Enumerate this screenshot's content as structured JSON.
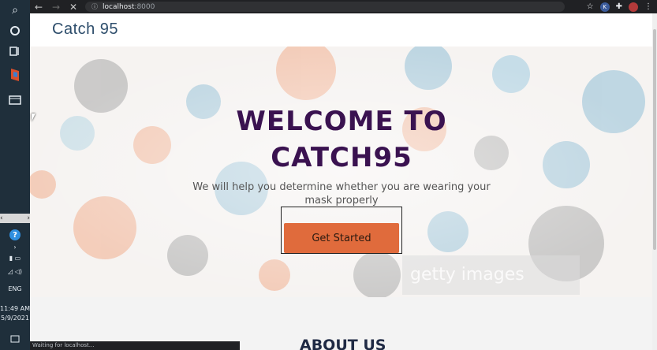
{
  "taskbar": {
    "icons": [
      "search-icon",
      "cortana-icon",
      "task-view-icon",
      "app-icon",
      "window-icon"
    ],
    "clock": {
      "time": "11:49 AM",
      "date": "5/9/2021"
    },
    "lang": "ENG",
    "help_glyph": "?"
  },
  "browser": {
    "url_host": "localhost",
    "url_port": ":8000",
    "extension_label": "K",
    "status_text": "Waiting for localhost..."
  },
  "site": {
    "brand": "Catch 95",
    "hero": {
      "title_line1": "WELCOME TO",
      "title_line2": "CATCH95",
      "subtitle": "We will help you determine whether you are wearing your mask properly",
      "cta_label": "Get Started",
      "watermark": "getty images"
    },
    "about_title": "ABOUT US"
  },
  "colors": {
    "title": "#3a1250",
    "cta": "#e06b3c",
    "brand": "#2d4d6b"
  }
}
